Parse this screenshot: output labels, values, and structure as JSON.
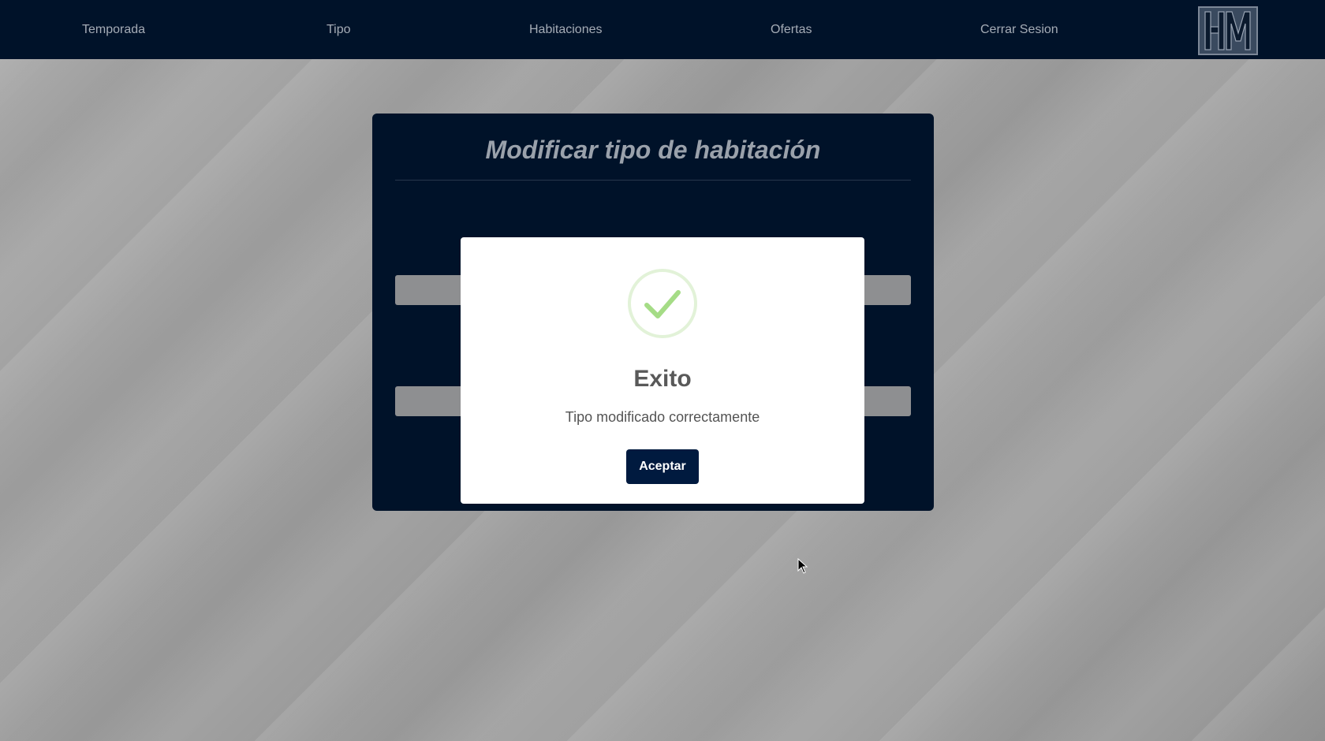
{
  "nav": {
    "items": [
      {
        "label": "Temporada"
      },
      {
        "label": "Tipo"
      },
      {
        "label": "Habitaciones"
      },
      {
        "label": "Ofertas"
      },
      {
        "label": "Cerrar Sesion"
      }
    ],
    "logo_text": "HM"
  },
  "form": {
    "title": "Modificar tipo de habitación"
  },
  "modal": {
    "icon": "success-check-icon",
    "title": "Exito",
    "message": "Tipo modificado correctamente",
    "button_label": "Aceptar"
  },
  "colors": {
    "navbar": "#001229",
    "accent_button": "#001a3f",
    "success_check": "#a5dc86"
  }
}
